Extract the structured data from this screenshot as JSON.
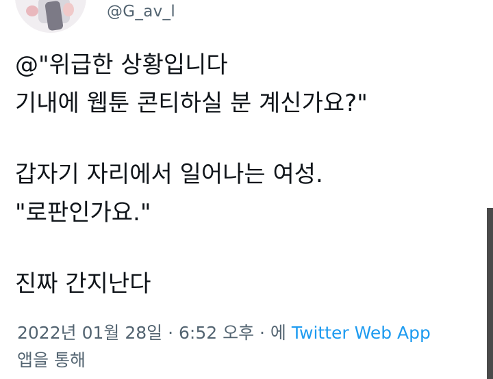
{
  "tweet": {
    "handle": "@G_av_l",
    "lines": [
      "@\"위급한 상황입니다",
      "기내에 웹툰 콘티하실 분 계신가요?\"",
      "갑자기 자리에서 일어나는 여성.",
      "\"로판인가요.\"",
      "진짜 간지난다"
    ],
    "date": "2022년 01월 28일",
    "separator1": " · ",
    "time": "6:52 오후",
    "separator2": " · ",
    "via_prefix": "에 ",
    "source": "Twitter Web App",
    "via_suffix": "앱을 통해"
  },
  "colors": {
    "text": "#0f1419",
    "meta": "#536471",
    "link": "#1d9bf0"
  }
}
